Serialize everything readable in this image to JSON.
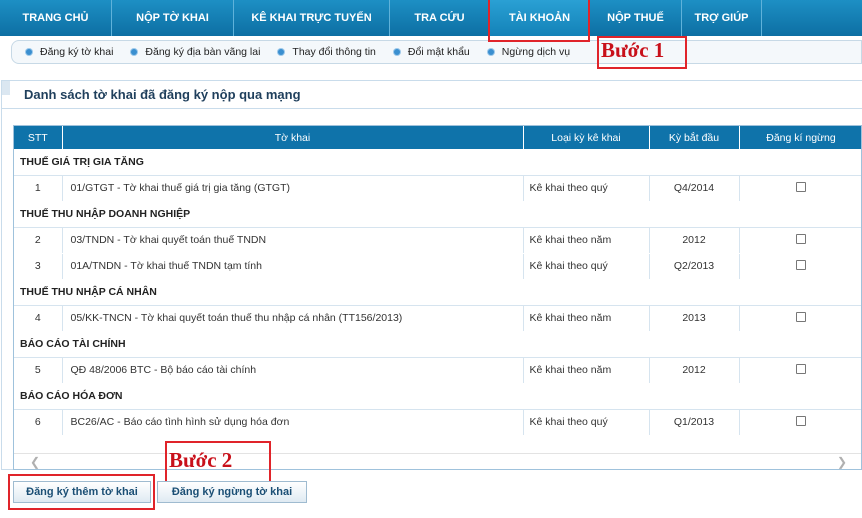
{
  "nav": {
    "items": [
      {
        "label": "TRANG CHỦ"
      },
      {
        "label": "NỘP TỜ KHAI"
      },
      {
        "label": "KÊ KHAI TRỰC TUYẾN"
      },
      {
        "label": "TRA CỨU"
      },
      {
        "label": "TÀI KHOẢN",
        "active": true
      },
      {
        "label": "NỘP THUẾ"
      },
      {
        "label": "TRỢ GIÚP"
      }
    ]
  },
  "subnav": {
    "items": [
      {
        "label": "Đăng ký tờ khai"
      },
      {
        "label": "Đăng ký địa bàn vãng lai"
      },
      {
        "label": "Thay đổi thông tin"
      },
      {
        "label": "Đổi mật khẩu"
      },
      {
        "label": "Ngừng dịch vụ"
      }
    ]
  },
  "annotations": {
    "step1": "Bước 1",
    "step2": "Bước 2",
    "color": "#e0242a"
  },
  "panel": {
    "title": "Danh sách tờ khai đã đăng ký nộp qua mạng"
  },
  "table": {
    "headers": {
      "stt": "STT",
      "form": "Tờ khai",
      "period_type": "Loại kỳ kê khai",
      "start_period": "Kỳ bắt đầu",
      "stop": "Đăng kí ngừng"
    },
    "groups": [
      {
        "name": "THUẾ GIÁ TRỊ GIA TĂNG",
        "rows": [
          {
            "stt": "1",
            "form": "01/GTGT - Tờ khai thuế giá trị gia tăng (GTGT)",
            "period_type": "Kê khai theo quý",
            "start_period": "Q4/2014",
            "checked": false
          }
        ]
      },
      {
        "name": "THUẾ THU NHẬP DOANH NGHIỆP",
        "rows": [
          {
            "stt": "2",
            "form": "03/TNDN - Tờ khai quyết toán thuế TNDN",
            "period_type": "Kê khai theo năm",
            "start_period": "2012",
            "checked": false
          },
          {
            "stt": "3",
            "form": "01A/TNDN - Tờ khai thuế TNDN tạm tính",
            "period_type": "Kê khai theo quý",
            "start_period": "Q2/2013",
            "checked": false
          }
        ]
      },
      {
        "name": "THUẾ THU NHẬP CÁ NHÂN",
        "rows": [
          {
            "stt": "4",
            "form": "05/KK-TNCN - Tờ khai quyết toán thuế thu nhập cá nhân (TT156/2013)",
            "period_type": "Kê khai theo năm",
            "start_period": "2013",
            "checked": false
          }
        ]
      },
      {
        "name": "BÁO CÁO TÀI CHÍNH",
        "rows": [
          {
            "stt": "5",
            "form": "QĐ 48/2006 BTC - Bộ báo cáo tài chính",
            "period_type": "Kê khai theo năm",
            "start_period": "2012",
            "checked": false
          }
        ]
      },
      {
        "name": "BÁO CÁO HÓA ĐƠN",
        "rows": [
          {
            "stt": "6",
            "form": "BC26/AC - Báo cáo tình hình sử dụng hóa đơn",
            "period_type": "Kê khai theo quý",
            "start_period": "Q1/2013",
            "checked": false
          }
        ]
      }
    ]
  },
  "buttons": {
    "add": "Đăng ký thêm tờ khai",
    "stop": "Đăng ký ngừng tờ khai"
  },
  "colors": {
    "nav": "#0d6fa3",
    "table_header": "#0f73aa",
    "annotation": "#e0242a"
  }
}
